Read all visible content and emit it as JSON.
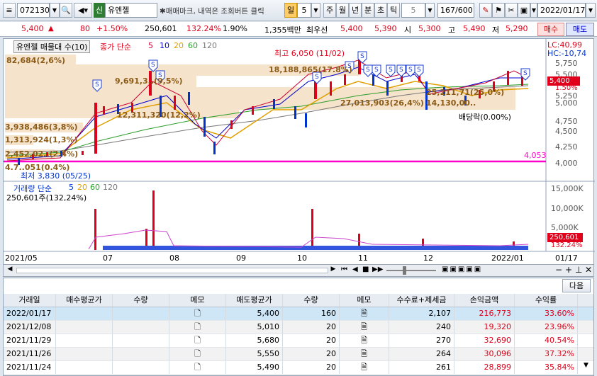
{
  "toolbar": {
    "code": "072130",
    "stock_badge": "신",
    "stock_name": "유엔젤",
    "notice": "✱매매마크, 내역은 조회버튼 클릭",
    "period_active": "일",
    "period_value": "5",
    "periods": [
      "주",
      "월",
      "년",
      "분",
      "초",
      "틱"
    ],
    "tick_value": "5",
    "count": "167",
    "count_total": "/600",
    "date": "2022/01/17"
  },
  "price_bar": {
    "price": "5,400",
    "change_arrow": "▲",
    "change": "80",
    "change_pct": "+1.50%",
    "volume": "250,601",
    "volume_ratio": "132.24%",
    "turnover": "1.90%",
    "amount": "1,355백만",
    "best_ask_label": "최우선",
    "best_ask": "5,400",
    "best_bid": "5,390",
    "open_label": "시",
    "open": "5,300",
    "high_label": "고",
    "high": "5,490",
    "low_label": "저",
    "low": "5,290",
    "buy_label": "매수",
    "sell_label": "매도"
  },
  "chart": {
    "title": "유엔젤 매물대 수(10)",
    "ma_label": "종가 단순",
    "ma_periods": [
      "5",
      "10",
      "20",
      "60",
      "120"
    ],
    "lc": "LC:40,99",
    "hc": "HC:-10,74",
    "high_note": "최고 6,050 (11/02)",
    "low_note": "최저 3,830 (05/25)",
    "dividend_note": "배당락(0.00%)",
    "line_value": "4,053",
    "price_tag": "5,400",
    "pct_tag": "1.50%",
    "vol_tag": "250,601",
    "vol_pct_tag": "132.24%",
    "vol_title": "거래량 단순",
    "vol_ma": [
      "5",
      "20",
      "60",
      "120"
    ],
    "vol_value": "250,601주(132,24%)",
    "price_axis": [
      "5,750",
      "5,500",
      "5,250",
      "5,000",
      "4,750",
      "4,500",
      "4,250",
      "4,000"
    ],
    "vol_axis": [
      "15,000K",
      "10,000K",
      "5,000K"
    ],
    "date_axis": [
      "2021/05",
      "07",
      "08",
      "09",
      "10",
      "11",
      "12",
      "2022/01",
      "01/17"
    ],
    "volume_profile": [
      {
        "label": "82,684(2,6%)",
        "value": 82684
      },
      {
        "label": "18,188,865(17.8%)",
        "value": 18188865
      },
      {
        "label": "9,691,3..(9,5%)",
        "value": 9691300
      },
      {
        "label": "27,013,903(26,4%)",
        "value": 27013903
      },
      {
        "label": "12,311,320(12,2%)",
        "value": 12311320
      },
      {
        "label": "3,938,486(3,8%)",
        "value": 3938486
      },
      {
        "label": "1,313,924(1,3%)",
        "value": 1313924
      },
      {
        "label": "2,452,02..(2.4%)",
        "value": 2452020
      },
      {
        "label": "4.7..051(0.4%)",
        "value": 470051
      },
      {
        "label": "25,211,71(25,0%)",
        "value": 25211710
      },
      {
        "label": "14,130,00..",
        "value": 14130000
      }
    ]
  },
  "table": {
    "next_label": "다음",
    "headers": [
      "거래일",
      "매수평균가",
      "수량",
      "메모",
      "매도평균가",
      "수량",
      "메모",
      "수수료+제세금",
      "손익금액",
      "수익률"
    ],
    "rows": [
      {
        "date": "2022/01/17",
        "buy_avg": "",
        "buy_qty": "",
        "sell_avg": "5,400",
        "sell_qty": "160",
        "fee": "2,107",
        "pnl": "216,773",
        "ret": "33.60%"
      },
      {
        "date": "2021/12/08",
        "buy_avg": "",
        "buy_qty": "",
        "sell_avg": "5,010",
        "sell_qty": "20",
        "fee": "240",
        "pnl": "19,320",
        "ret": "23.96%"
      },
      {
        "date": "2021/11/29",
        "buy_avg": "",
        "buy_qty": "",
        "sell_avg": "5,680",
        "sell_qty": "20",
        "fee": "270",
        "pnl": "32,690",
        "ret": "40.54%"
      },
      {
        "date": "2021/11/26",
        "buy_avg": "",
        "buy_qty": "",
        "sell_avg": "5,550",
        "sell_qty": "20",
        "fee": "264",
        "pnl": "30,096",
        "ret": "37.32%"
      },
      {
        "date": "2021/11/24",
        "buy_avg": "",
        "buy_qty": "",
        "sell_avg": "5,490",
        "sell_qty": "20",
        "fee": "261",
        "pnl": "28,899",
        "ret": "35.84%"
      }
    ]
  },
  "colors": {
    "up": "#e0001b",
    "down": "#0033cc",
    "magenta": "#ff00cc",
    "profile": "#f6e3cc",
    "profile_text": "#8b5a14"
  }
}
